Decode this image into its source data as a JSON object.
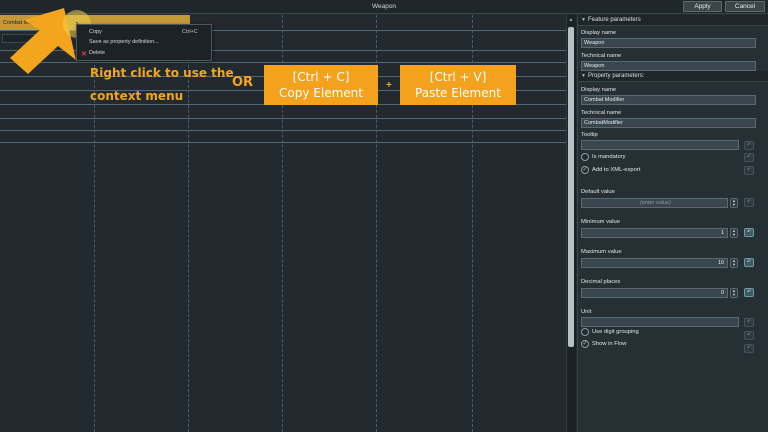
{
  "window": {
    "title": "Weapon",
    "apply_label": "Apply",
    "cancel_label": "Cancel"
  },
  "canvas": {
    "element_label": "Combat Mo",
    "context_menu": {
      "items": [
        {
          "label": "Copy",
          "shortcut": "Ctrl+C"
        },
        {
          "label": "Save as property definition..."
        },
        {
          "label": "Delete",
          "icon": "delete-x-icon"
        }
      ]
    }
  },
  "overlay": {
    "line1": "Right click to use the",
    "line2": "context menu",
    "or": "OR",
    "copy_key": "[Ctrl + C]",
    "copy_text": "Copy Element",
    "plus": "+",
    "paste_key": "[Ctrl + V]",
    "paste_text": "Paste Element",
    "accent_color": "#f3a51d"
  },
  "panel": {
    "feature_section": "Feature parameters",
    "display_name_label": "Display name",
    "display_name_value": "Weapon",
    "technical_name_label": "Technical name",
    "technical_name_value": "Weapon",
    "property_section": "Property parameters:",
    "prop_display_name_label": "Display name",
    "prop_display_name_value": "Combat Modifier",
    "prop_technical_name_label": "Technical name",
    "prop_technical_name_value": "CombatModifier",
    "tooltip_label": "Tooltip",
    "tooltip_value": "",
    "is_mandatory_label": "Is mandatory",
    "is_mandatory_checked": false,
    "xml_export_label": "Add to XML-export",
    "xml_export_checked": true,
    "default_value_label": "Default value",
    "default_value_placeholder": "(enter value)",
    "min_label": "Minimum value",
    "min_value": "1",
    "max_label": "Maximum value",
    "max_value": "10",
    "decimals_label": "Decimal places",
    "decimals_value": "0",
    "unit_label": "Unit",
    "unit_value": "",
    "digit_grouping_label": "Use digit grouping",
    "digit_grouping_checked": false,
    "show_in_flow_label": "Show in Flow",
    "show_in_flow_checked": true
  }
}
